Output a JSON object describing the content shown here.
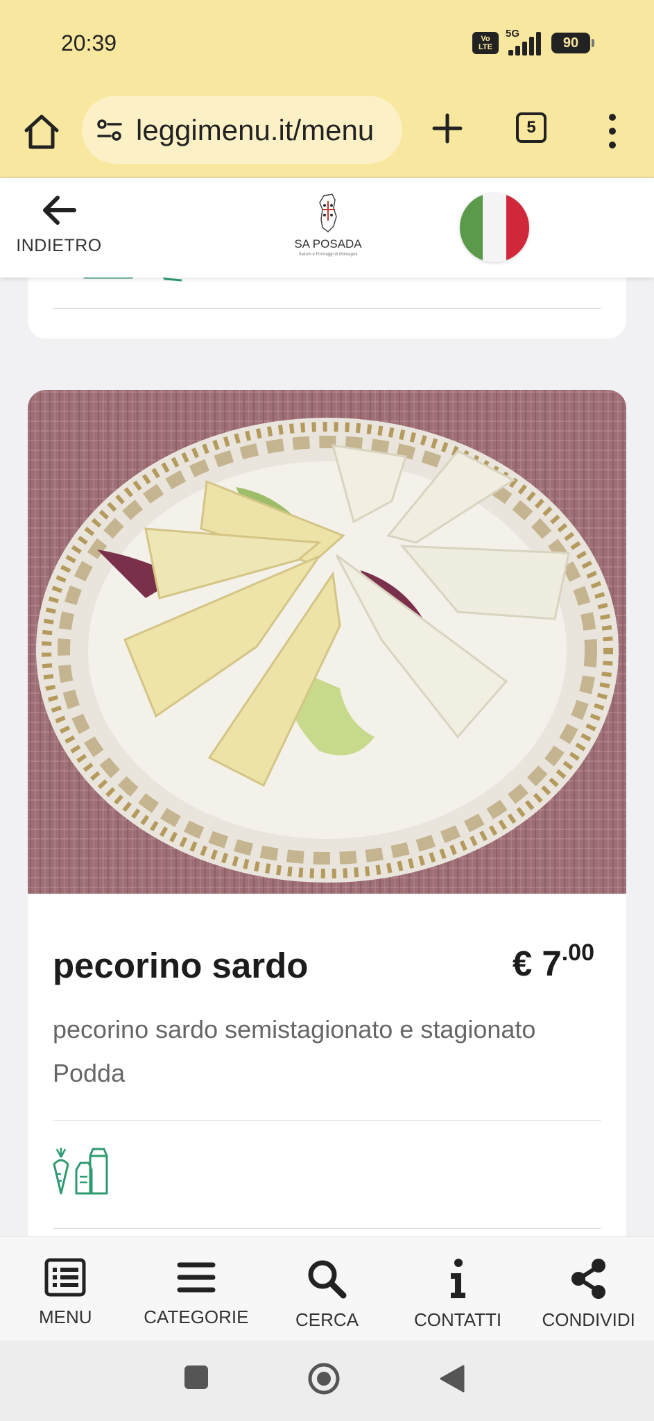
{
  "status_bar": {
    "time": "20:39",
    "volte": "Vo LTE",
    "network": "5G",
    "battery": "90"
  },
  "browser": {
    "url": "leggimenu.it/menu",
    "tab_count": "5"
  },
  "header": {
    "back_label": "INDIETRO",
    "logo_text": "SA POSADA",
    "logo_subtext": "Salumi e Formaggi di Montagna",
    "language_flag": "italy-flag-icon"
  },
  "item": {
    "name": "pecorino sardo",
    "price_currency": "€ 7",
    "price_cents": ".00",
    "description": "pecorino sardo semistagionato e stagionato Podda",
    "allergen_icons": [
      "vegetarian-icon",
      "milk-icon"
    ]
  },
  "bottom_nav": {
    "items": [
      {
        "label": "MENU",
        "icon": "menu-list-icon"
      },
      {
        "label": "CATEGORIE",
        "icon": "categories-icon"
      },
      {
        "label": "CERCA",
        "icon": "search-icon"
      },
      {
        "label": "CONTATTI",
        "icon": "info-icon"
      },
      {
        "label": "CONDIVIDI",
        "icon": "share-icon"
      }
    ]
  },
  "colors": {
    "browser_bar": "#f8e79e",
    "allergen_icon": "#2e9a6f",
    "text_dark": "#1c1c1c",
    "text_muted": "#666666"
  }
}
